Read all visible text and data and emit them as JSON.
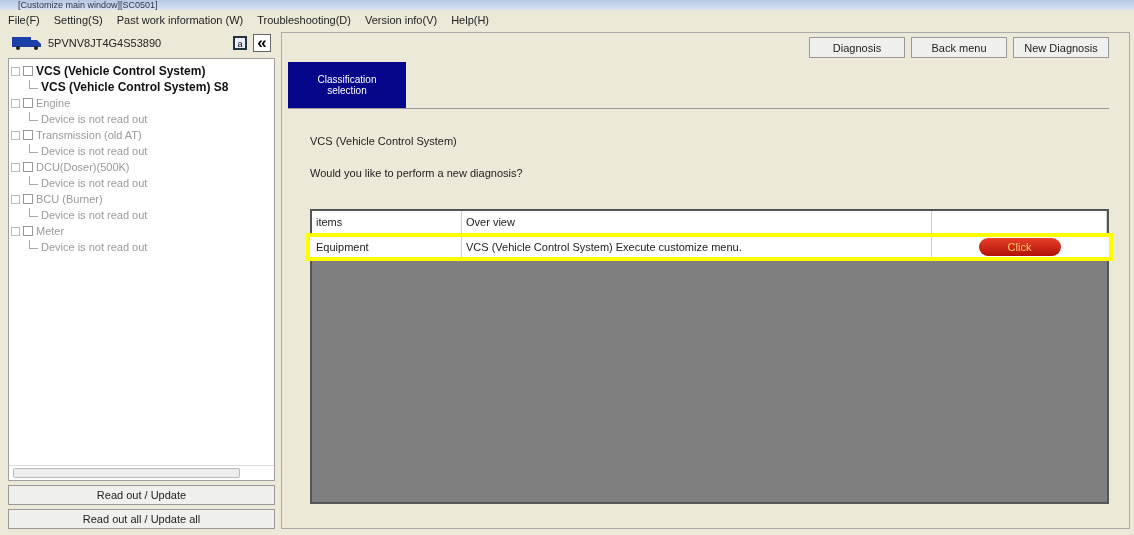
{
  "window": {
    "title": "[Customize main window][SC0501]"
  },
  "menu": [
    "File(F)",
    "Setting(S)",
    "Past work information (W)",
    "Troubleshooting(D)",
    "Version info(V)",
    "Help(H)"
  ],
  "vehicle": {
    "vin": "5PVNV8JT4G4S53890",
    "small_button": "a",
    "collapse_button": "«"
  },
  "tree": [
    {
      "label": "VCS (Vehicle Control System)",
      "active": true,
      "children": [
        {
          "label": "VCS (Vehicle Control System) S8",
          "active": true
        }
      ]
    },
    {
      "label": "Engine",
      "active": false,
      "children": [
        {
          "label": "Device is not read out",
          "active": false
        }
      ]
    },
    {
      "label": "Transmission (old AT)",
      "active": false,
      "children": [
        {
          "label": "Device is not read out",
          "active": false
        }
      ]
    },
    {
      "label": "DCU(Doser)(500K)",
      "active": false,
      "children": [
        {
          "label": "Device is not read out",
          "active": false
        }
      ]
    },
    {
      "label": "BCU (Burner)",
      "active": false,
      "children": [
        {
          "label": "Device is not read out",
          "active": false
        }
      ]
    },
    {
      "label": "Meter",
      "active": false,
      "children": [
        {
          "label": "Device is not read out",
          "active": false
        }
      ]
    }
  ],
  "side_buttons": [
    "Read out / Update",
    "Read out all / Update all"
  ],
  "toolbar_buttons": [
    "Diagnosis",
    "Back menu",
    "New Diagnosis"
  ],
  "tabs": [
    {
      "label": "Classification selection",
      "selected": true
    }
  ],
  "heading": "VCS (Vehicle Control System)",
  "question": "Would you like to perform a new diagnosis?",
  "table": {
    "columns": [
      "items",
      "Over view"
    ],
    "rows": [
      {
        "cells": [
          "Equipment",
          "VCS (Vehicle Control System) Execute customize menu."
        ],
        "action": "Click",
        "highlighted": true
      }
    ]
  }
}
